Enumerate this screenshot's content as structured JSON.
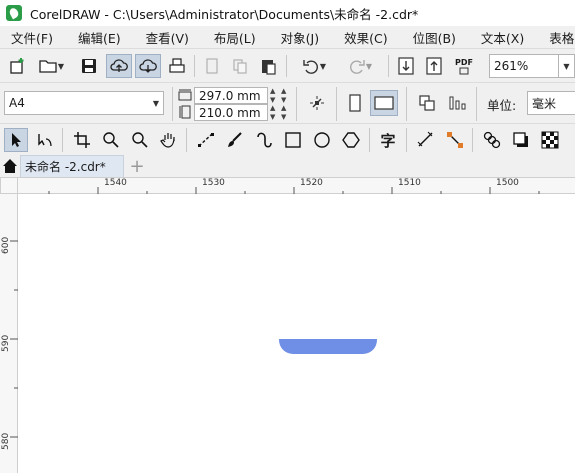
{
  "window": {
    "title": "CorelDRAW - C:\\Users\\Administrator\\Documents\\未命名 -2.cdr*"
  },
  "menu": {
    "items": [
      {
        "label": "文件(F)"
      },
      {
        "label": "编辑(E)"
      },
      {
        "label": "查看(V)"
      },
      {
        "label": "布局(L)"
      },
      {
        "label": "对象(J)"
      },
      {
        "label": "效果(C)"
      },
      {
        "label": "位图(B)"
      },
      {
        "label": "文本(X)"
      },
      {
        "label": "表格(T)"
      }
    ]
  },
  "toolbar": {
    "pdf_label": "PDF",
    "zoom_value": "261%"
  },
  "property_bar": {
    "page_size": "A4",
    "width_value": "297.0 mm",
    "height_value": "210.0 mm",
    "units_label": "单位:",
    "units_value": "毫米"
  },
  "toolbox": {
    "text_tool_glyph": "字"
  },
  "tabs": {
    "document_tab": "未命名 -2.cdr*",
    "add_tab": "+"
  },
  "rulers": {
    "horizontal": [
      "1540",
      "1530",
      "1520",
      "1510",
      "1500"
    ],
    "vertical": [
      "600",
      "590",
      "580"
    ]
  },
  "colors": {
    "shape_fill": "#6f8ee6",
    "active_button": "#c9d5e2",
    "accent_green": "#2b9d48",
    "logo_fill": "#f0e6c8"
  }
}
